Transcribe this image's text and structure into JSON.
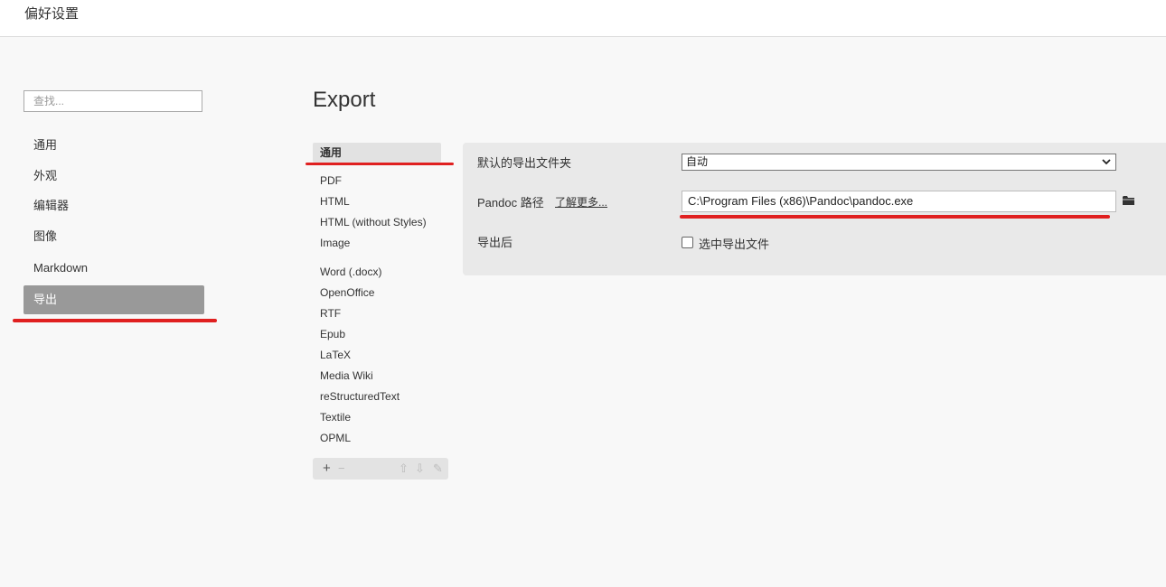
{
  "window": {
    "title": "偏好设置"
  },
  "search": {
    "placeholder": "查找..."
  },
  "sidebar": {
    "items": [
      {
        "label": "通用"
      },
      {
        "label": "外观"
      },
      {
        "label": "编辑器"
      },
      {
        "label": "图像"
      },
      {
        "label": "Markdown"
      },
      {
        "label": "导出",
        "active": true
      }
    ]
  },
  "page": {
    "title": "Export"
  },
  "formats": {
    "items": [
      {
        "label": "通用",
        "active": true
      },
      {
        "label": "PDF"
      },
      {
        "label": "HTML"
      },
      {
        "label": "HTML (without Styles)"
      },
      {
        "label": "Image"
      },
      {
        "label": "Word (.docx)"
      },
      {
        "label": "OpenOffice"
      },
      {
        "label": "RTF"
      },
      {
        "label": "Epub"
      },
      {
        "label": "LaTeX"
      },
      {
        "label": "Media Wiki"
      },
      {
        "label": "reStructuredText"
      },
      {
        "label": "Textile"
      },
      {
        "label": "OPML"
      }
    ],
    "toolbar": {
      "add": "+",
      "remove": "−",
      "up": "⇧",
      "down": "⇩",
      "edit": "✎"
    }
  },
  "settings": {
    "export_folder": {
      "label": "默认的导出文件夹",
      "value": "自动"
    },
    "pandoc": {
      "label": "Pandoc 路径",
      "link": "了解更多...",
      "value": "C:\\Program Files (x86)\\Pandoc\\pandoc.exe"
    },
    "after_export": {
      "label": "导出后",
      "checkbox_label": "选中导出文件",
      "checked": false
    }
  },
  "colors": {
    "highlight": "#e02020",
    "active_sidebar": "#999999"
  },
  "icons": {
    "folder": "folder-icon",
    "dropdown": "chevron-down-icon"
  }
}
